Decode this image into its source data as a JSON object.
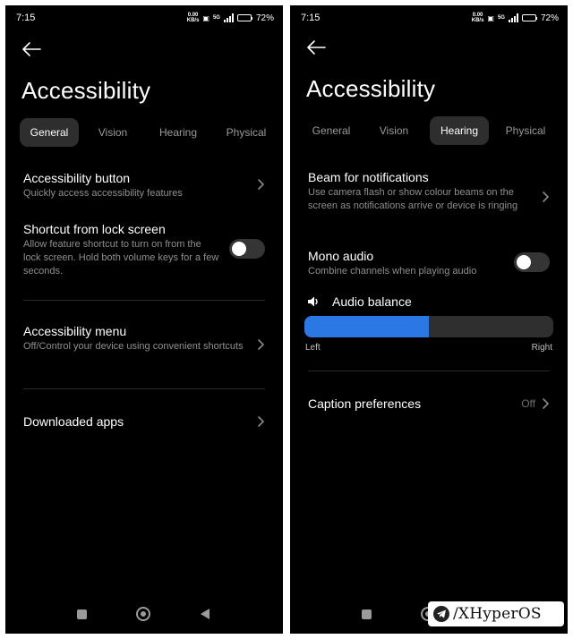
{
  "status": {
    "time": "7:15",
    "speed_value": "0.00",
    "speed_unit": "KB/s",
    "network": "5G",
    "battery": "72%",
    "battery_level": 0.72
  },
  "title": "Accessibility",
  "tabs": [
    "General",
    "Vision",
    "Hearing",
    "Physical"
  ],
  "general": {
    "active_tab": "General",
    "items": [
      {
        "title": "Accessibility button",
        "subtitle": "Quickly access accessibility features"
      },
      {
        "title": "Shortcut from lock screen",
        "subtitle": "Allow feature shortcut to turn on from the lock screen. Hold both volume keys for a few seconds.",
        "toggle": false
      },
      {
        "title": "Accessibility menu",
        "subtitle": "Off/Control your device using convenient shortcuts"
      },
      {
        "title": "Downloaded apps"
      }
    ]
  },
  "hearing": {
    "active_tab": "Hearing",
    "items": [
      {
        "title": "Beam for notifications",
        "subtitle": "Use camera flash or show colour beams on the screen as notifications arrive or device is ringing"
      },
      {
        "title": "Mono audio",
        "subtitle": "Combine channels when playing audio",
        "toggle": false
      },
      {
        "title": "Caption preferences",
        "value": "Off"
      }
    ],
    "audio_balance": {
      "label": "Audio balance",
      "left_label": "Left",
      "right_label": "Right",
      "level": 0.5
    }
  },
  "watermark": {
    "text": "/XHyperOS"
  },
  "colors": {
    "accent": "#2b78e4",
    "background": "#000000",
    "tab_active": "#2e2e2e"
  }
}
